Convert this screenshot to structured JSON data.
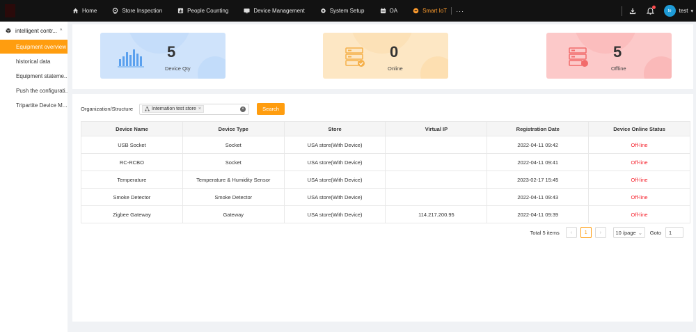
{
  "nav": {
    "items": [
      {
        "label": "Home",
        "icon": "home-icon"
      },
      {
        "label": "Store Inspection",
        "icon": "camera-icon"
      },
      {
        "label": "People Counting",
        "icon": "chart-icon"
      },
      {
        "label": "Device Management",
        "icon": "monitor-icon"
      },
      {
        "label": "System Setup",
        "icon": "gear-icon"
      },
      {
        "label": "OA",
        "icon": "calendar-icon"
      },
      {
        "label": "Smart IoT",
        "icon": "iot-icon"
      }
    ],
    "more": "···"
  },
  "user": {
    "avatar_text": "te",
    "name": "test"
  },
  "sidebar": {
    "group": "intelligent contr...",
    "items": [
      {
        "label": "Equipment overview"
      },
      {
        "label": "historical data"
      },
      {
        "label": "Equipment stateme..."
      },
      {
        "label": "Push the configurati..."
      },
      {
        "label": "Tripartite Device M..."
      }
    ]
  },
  "stats": {
    "qty": {
      "value": "5",
      "label": "Device Qty"
    },
    "online": {
      "value": "0",
      "label": "Online"
    },
    "offline": {
      "value": "5",
      "label": "Offline"
    }
  },
  "filter": {
    "label": "Organization/Structure",
    "tag": "Internation test store",
    "search_label": "Search"
  },
  "table": {
    "headers": [
      "Device Name",
      "Device Type",
      "Store",
      "Virtual IP",
      "Registration Date",
      "Device Online Status"
    ],
    "rows": [
      [
        "USB Socket",
        "Socket",
        "USA store(With Device)",
        "",
        "2022-04-11 09:42",
        "Off-line"
      ],
      [
        "RC-RCBO",
        "Socket",
        "USA store(With Device)",
        "",
        "2022-04-11 09:41",
        "Off-line"
      ],
      [
        "Temperature",
        "Temperature & Humidity Sensor",
        "USA store(With Device)",
        "",
        "2023-02-17 15:45",
        "Off-line"
      ],
      [
        "Smoke Detector",
        "Smoke Detector",
        "USA store(With Device)",
        "",
        "2022-04-11 09:43",
        "Off-line"
      ],
      [
        "Zigbee Gateway",
        "Gateway",
        "USA store(With Device)",
        "114.217.200.95",
        "2022-04-11 09:39",
        "Off-line"
      ]
    ]
  },
  "pager": {
    "total": "Total 5 items",
    "prev": "‹",
    "page": "1",
    "next": "›",
    "size": "10 /page",
    "goto_label": "Goto",
    "goto_value": "1"
  },
  "colors": {
    "accent": "#ff9d0f",
    "offline": "#f5222d"
  }
}
